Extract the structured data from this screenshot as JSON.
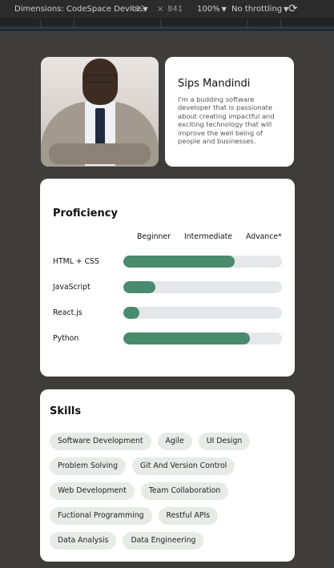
{
  "devtools": {
    "dimensions_label": "Dimensions: CodeSpace Device",
    "width": "402",
    "times": "×",
    "height": "841",
    "zoom": "100%",
    "throttling": "No throttling",
    "caret": "▼",
    "rotate_icon": "⟳"
  },
  "profile": {
    "photo_alt": "Profile photo",
    "name": "Sips Mandindi",
    "bio": "I'm a budding software developer that is passionate about creating impactful and exciting technology that will improve the well being of people and businesses."
  },
  "proficiency": {
    "title": "Proficiency",
    "levels": [
      "Beginner",
      "Intermediate",
      "Advance*"
    ],
    "items": [
      {
        "label": "HTML + CSS",
        "value": 0.7
      },
      {
        "label": "JavaScript",
        "value": 0.2
      },
      {
        "label": "React.js",
        "value": 0.1
      },
      {
        "label": "Python",
        "value": 0.8
      }
    ],
    "bar_color": "#4a8a6e",
    "track_color": "#e5e7ea"
  },
  "skills": {
    "title": "Skills",
    "items": [
      "Software Development",
      "Agile",
      "UI Design",
      "Problem Solving",
      "Git And Version Control",
      "Web Development",
      "Team Collaboration",
      "Fuctional Programming",
      "Restful APIs",
      "Data Analysis",
      "Data Engineering"
    ]
  }
}
